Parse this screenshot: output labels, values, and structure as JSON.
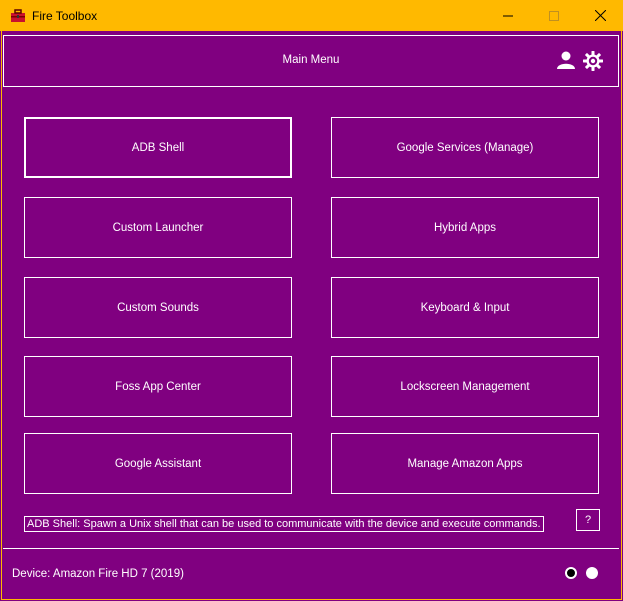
{
  "window": {
    "title": "Fire Toolbox",
    "titlebar_color": "#ffb900",
    "background_color": "#800080",
    "accent_color": "#ffffff"
  },
  "header": {
    "title": "Main Menu",
    "icons": [
      "user-icon",
      "gear-icon"
    ]
  },
  "menu": {
    "items": [
      {
        "label": "ADB Shell",
        "selected": true
      },
      {
        "label": "Google Services (Manage)"
      },
      {
        "label": "Custom Launcher"
      },
      {
        "label": "Hybrid Apps"
      },
      {
        "label": "Custom Sounds"
      },
      {
        "label": "Keyboard & Input"
      },
      {
        "label": "Foss App Center"
      },
      {
        "label": "Lockscreen Management"
      },
      {
        "label": "Google Assistant"
      },
      {
        "label": "Manage Amazon Apps"
      }
    ]
  },
  "description": {
    "text": "ADB Shell: Spawn a Unix shell that can be used to communicate with the device and execute commands."
  },
  "help": {
    "label": "?"
  },
  "footer": {
    "device": "Device: Amazon Fire HD 7 (2019)",
    "pages": [
      {
        "active": true
      },
      {
        "active": false
      }
    ]
  }
}
